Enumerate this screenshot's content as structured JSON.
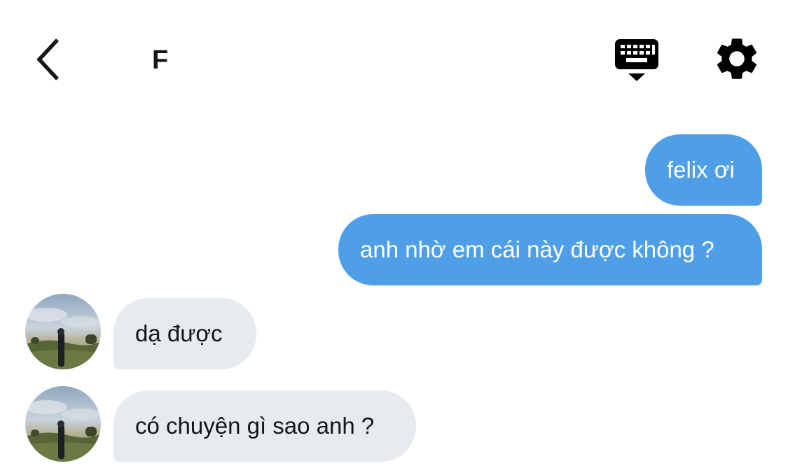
{
  "header": {
    "title": "F",
    "back_icon": "chevron-left-icon",
    "keyboard_icon": "keyboard-hide-icon",
    "settings_icon": "gear-icon"
  },
  "messages": [
    {
      "direction": "outgoing",
      "text": "felix ơi"
    },
    {
      "direction": "outgoing",
      "text": "anh nhờ em cái này được không ?"
    },
    {
      "direction": "incoming",
      "text": "dạ được"
    },
    {
      "direction": "incoming",
      "text": "có chuyện gì sao anh ?"
    }
  ],
  "colors": {
    "outgoing_bubble": "#4f9fe8",
    "incoming_bubble": "#e7eaee",
    "text_dark": "#14171a",
    "background": "#ffffff"
  }
}
